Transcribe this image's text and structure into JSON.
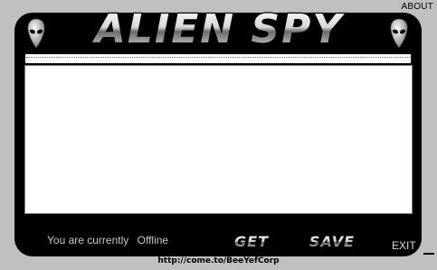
{
  "header": {
    "about_label": "ABOUT",
    "app_title": "ALIEN SPY"
  },
  "url_bar": {
    "value": ""
  },
  "status": {
    "prefix": "You are currently",
    "value": "Offline"
  },
  "buttons": {
    "get_label": "GET",
    "save_label": "SAVE",
    "exit_label": "EXIT"
  },
  "footer": {
    "link": "http://come.to/BeeYefCorp"
  },
  "colors": {
    "background": "#c0c0c0",
    "frame": "#000000",
    "status_text": "#c8c8c8"
  },
  "icons": {
    "left": "alien-head-icon",
    "right": "alien-head-icon"
  }
}
